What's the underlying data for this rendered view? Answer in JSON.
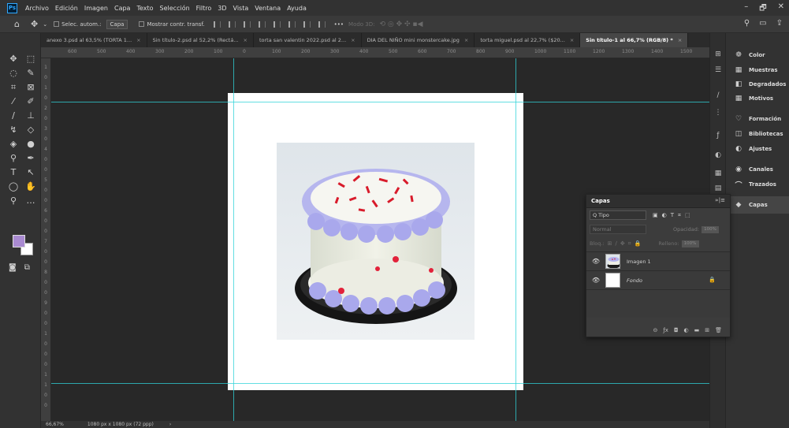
{
  "menu": {
    "app_icon": "Ps",
    "items": [
      "Archivo",
      "Edición",
      "Imagen",
      "Capa",
      "Texto",
      "Selección",
      "Filtro",
      "3D",
      "Vista",
      "Ventana",
      "Ayuda"
    ],
    "window_controls": [
      "–",
      "🗗",
      "✕"
    ]
  },
  "options": {
    "auto_select_label": "Selec. autom.:",
    "auto_select_value": "Capa",
    "transform_label": "Mostrar contr. transf.",
    "more": "•••",
    "mode_3d": "Modo 3D:"
  },
  "tabs": [
    {
      "label": "anexo 3.psd al 63,5% (TORTA 1..."
    },
    {
      "label": "Sin título-2.psd al 52,2% (Rectá..."
    },
    {
      "label": "torta san valentin 2022.psd al 2..."
    },
    {
      "label": "DIA DEL NIÑO mini monstercake.jpg"
    },
    {
      "label": "torta miguel.psd al 22,7% ($20..."
    },
    {
      "label": "Sin título-1 al 66,7% (RGB/8) *"
    }
  ],
  "ruler_top": [
    "600",
    "500",
    "400",
    "300",
    "200",
    "100",
    "0",
    "100",
    "200",
    "300",
    "400",
    "500",
    "600",
    "700",
    "800",
    "900",
    "1000",
    "1100",
    "1200",
    "1300",
    "1400",
    "1500",
    "1600"
  ],
  "ruler_left": [
    "1",
    "0",
    "1",
    "0",
    "2",
    "0",
    "3",
    "0",
    "4",
    "0",
    "0",
    "5",
    "0",
    "0",
    "6",
    "0",
    "0",
    "7",
    "0",
    "0",
    "8",
    "0",
    "0",
    "9",
    "0",
    "0",
    "1",
    "0",
    "0",
    "0",
    "1",
    "1",
    "0",
    "0"
  ],
  "status": {
    "zoom": "66,67%",
    "doc_size": "1080 px x 1080 px (72 ppp)",
    "arrow": "›"
  },
  "right_dock": [
    {
      "label": "Color",
      "icon": "color-icon"
    },
    {
      "label": "Muestras",
      "icon": "swatches-icon"
    },
    {
      "label": "Degradados",
      "icon": "gradients-icon"
    },
    {
      "label": "Motivos",
      "icon": "patterns-icon"
    },
    {
      "label": "Formación",
      "icon": "learn-icon"
    },
    {
      "label": "Bibliotecas",
      "icon": "libraries-icon"
    },
    {
      "label": "Ajustes",
      "icon": "adjustments-icon"
    },
    {
      "label": "Canales",
      "icon": "channels-icon"
    },
    {
      "label": "Trazados",
      "icon": "paths-icon"
    },
    {
      "label": "Capas",
      "icon": "layers-icon"
    }
  ],
  "layers_panel": {
    "title": "Capas",
    "filter_kind": "Q Tipo",
    "blend_mode": "Normal",
    "opacity_label": "Opacidad:",
    "opacity_value": "100%",
    "lock_label": "Bloq.:",
    "fill_label": "Relleno:",
    "fill_value": "100%",
    "layers": [
      {
        "name": "Imagen 1",
        "thumb": "cake"
      },
      {
        "name": "Fondo",
        "thumb": "white"
      }
    ]
  },
  "colors": {
    "foreground": "#a98ad1",
    "background": "#ffffff",
    "guide": "#2fd3d8"
  }
}
